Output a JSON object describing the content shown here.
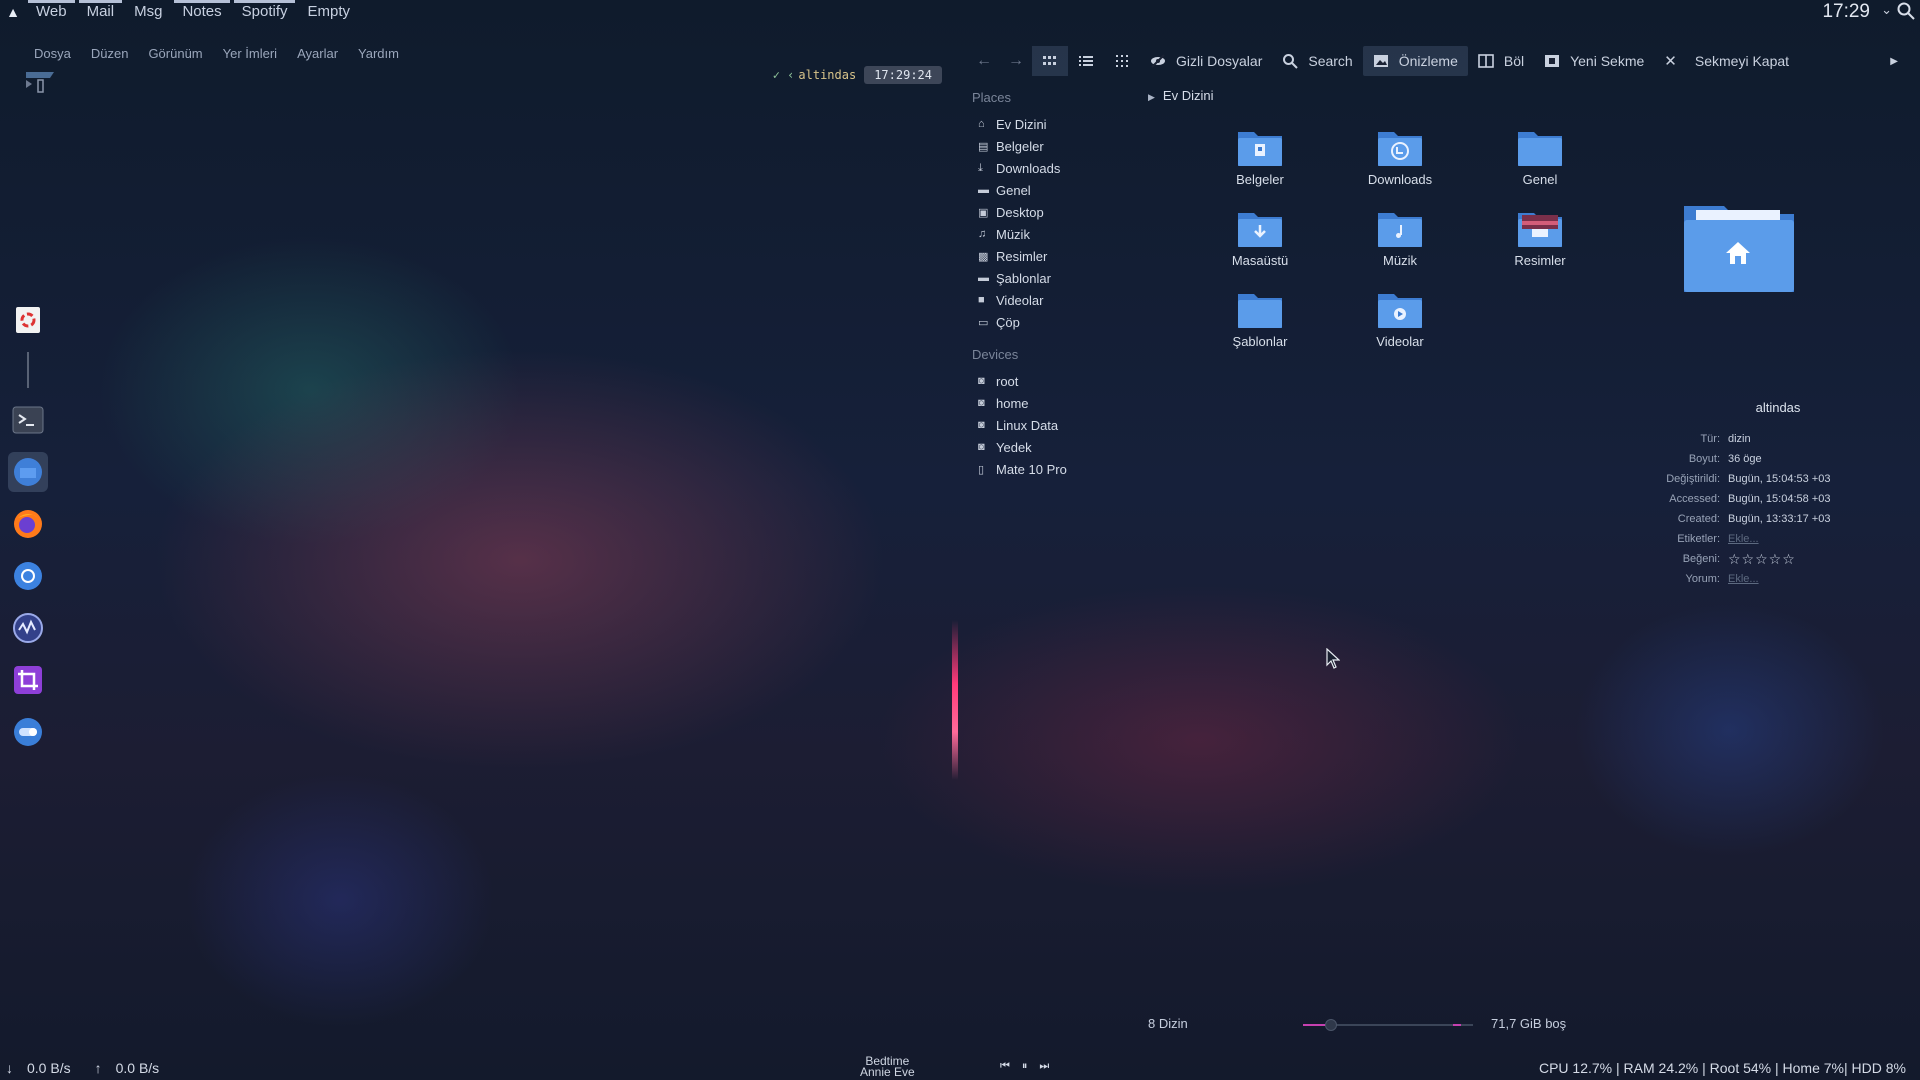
{
  "topbar": {
    "workspaces": [
      "Web",
      "Mail",
      "Msg",
      "Notes",
      "Spotify",
      "Empty"
    ],
    "clock": "17:29"
  },
  "terminal": {
    "menu": [
      "Dosya",
      "Düzen",
      "Görünüm",
      "Yer İmleri",
      "Ayarlar",
      "Yardım"
    ],
    "prompt_user": "altindas",
    "prompt_time": "17:29:24"
  },
  "dock": {
    "items": [
      "trash-app",
      "terminal-app",
      "files-app",
      "firefox-app",
      "chromium-app",
      "monitor-app",
      "crop-app",
      "toggle-app"
    ]
  },
  "filemanager": {
    "toolbar": {
      "hidden_files": "Gizli Dosyalar",
      "search": "Search",
      "preview": "Önizleme",
      "split": "Böl",
      "new_tab": "Yeni Sekme",
      "close_tab": "Sekmeyi Kapat"
    },
    "places_header": "Places",
    "places": [
      "Ev Dizini",
      "Belgeler",
      "Downloads",
      "Genel",
      "Desktop",
      "Müzik",
      "Resimler",
      "Şablonlar",
      "Videolar",
      "Çöp"
    ],
    "devices_header": "Devices",
    "devices": [
      "root",
      "home",
      "Linux Data",
      "Yedek",
      "Mate 10 Pro"
    ],
    "breadcrumb": "Ev Dizini",
    "folders": [
      "Belgeler",
      "Downloads",
      "Genel",
      "Masaüstü",
      "Müzik",
      "Resimler",
      "Şablonlar",
      "Videolar"
    ],
    "info": {
      "name": "altindas",
      "rows": [
        {
          "k": "Tür:",
          "v": "dizin"
        },
        {
          "k": "Boyut:",
          "v": "36 öge"
        },
        {
          "k": "Değiştirildi:",
          "v": "Bugün, 15:04:53 +03"
        },
        {
          "k": "Accessed:",
          "v": "Bugün, 15:04:58 +03"
        },
        {
          "k": "Created:",
          "v": "Bugün, 13:33:17 +03"
        },
        {
          "k": "Etiketler:",
          "v": "Ekle..."
        },
        {
          "k": "Beğeni:",
          "v": "☆☆☆☆☆"
        },
        {
          "k": "Yorum:",
          "v": "Ekle..."
        }
      ]
    },
    "status": {
      "count": "8 Dizin",
      "free": "71,7 GiB boş"
    }
  },
  "bottombar": {
    "down": "0.0 B/s",
    "up": "0.0 B/s",
    "song_title": "Bedtime",
    "song_artist": "Annie Eve",
    "sys": "CPU 12.7% | RAM 24.2% | Root 54% | Home 7%| HDD 8%"
  }
}
